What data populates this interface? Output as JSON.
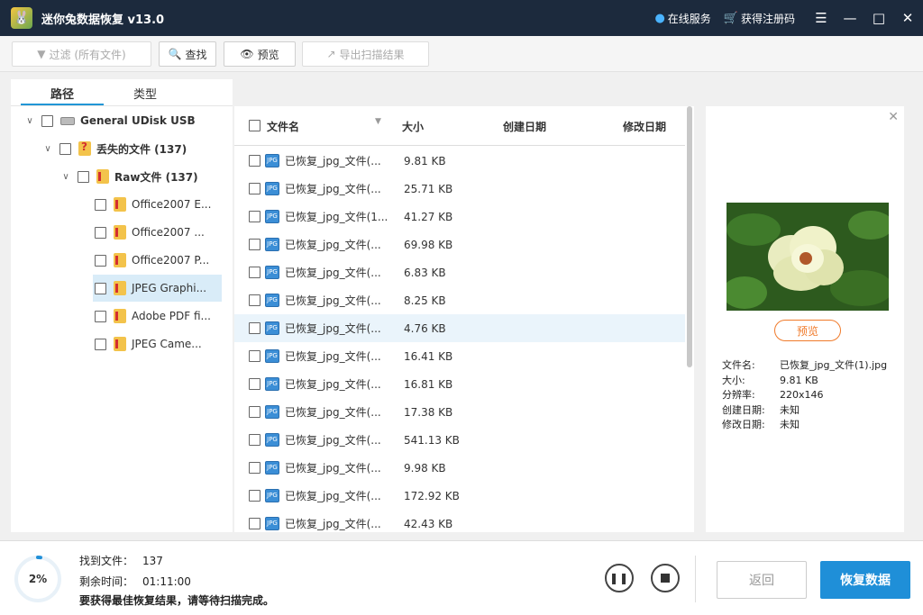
{
  "app": {
    "title": "迷你兔数据恢复 v13.0"
  },
  "titlebar": {
    "online_service": "在线服务",
    "get_code": "获得注册码"
  },
  "toolbar": {
    "filter_label": "过滤 (所有文件)",
    "search_label": "查找",
    "preview_label": "预览",
    "export_label": "导出扫描结果"
  },
  "left": {
    "tabs": [
      "路径",
      "类型"
    ],
    "tree": [
      {
        "label": "General UDisk USB",
        "bold": true
      },
      {
        "label": "丢失的文件 (137)",
        "bold": true
      },
      {
        "label": "Raw文件 (137)",
        "bold": true
      },
      {
        "label": "Office2007 E..."
      },
      {
        "label": "Office2007 ..."
      },
      {
        "label": "Office2007 P..."
      },
      {
        "label": "JPEG Graphi...",
        "selected": true
      },
      {
        "label": "Adobe PDF fi..."
      },
      {
        "label": "JPEG Came..."
      }
    ]
  },
  "list": {
    "headers": {
      "name": "文件名",
      "size": "大小",
      "created": "创建日期",
      "modified": "修改日期"
    },
    "rows": [
      {
        "name": "已恢复_jpg_文件(...",
        "size": "9.81 KB"
      },
      {
        "name": "已恢复_jpg_文件(...",
        "size": "25.71 KB"
      },
      {
        "name": "已恢复_jpg_文件(1...",
        "size": "41.27 KB"
      },
      {
        "name": "已恢复_jpg_文件(...",
        "size": "69.98 KB"
      },
      {
        "name": "已恢复_jpg_文件(...",
        "size": "6.83 KB"
      },
      {
        "name": "已恢复_jpg_文件(...",
        "size": "8.25 KB"
      },
      {
        "name": "已恢复_jpg_文件(...",
        "size": "4.76 KB",
        "selected": true
      },
      {
        "name": "已恢复_jpg_文件(...",
        "size": "16.41 KB"
      },
      {
        "name": "已恢复_jpg_文件(...",
        "size": "16.81 KB"
      },
      {
        "name": "已恢复_jpg_文件(...",
        "size": "17.38 KB"
      },
      {
        "name": "已恢复_jpg_文件(...",
        "size": "541.13 KB"
      },
      {
        "name": "已恢复_jpg_文件(...",
        "size": "9.98 KB"
      },
      {
        "name": "已恢复_jpg_文件(...",
        "size": "172.92 KB"
      },
      {
        "name": "已恢复_jpg_文件(...",
        "size": "42.43 KB"
      }
    ]
  },
  "preview": {
    "button": "预览",
    "info": [
      {
        "key": "文件名:",
        "value": "已恢复_jpg_文件(1).jpg"
      },
      {
        "key": "大小:",
        "value": "9.81 KB"
      },
      {
        "key": "分辨率:",
        "value": "220x146"
      },
      {
        "key": "创建日期:",
        "value": "未知"
      },
      {
        "key": "修改日期:",
        "value": "未知"
      }
    ]
  },
  "footer": {
    "progress_percent": 2,
    "progress_label": "2%",
    "found_label": "找到文件：",
    "found_value": "137",
    "remaining_label": "剩余时间：",
    "remaining_value": "01:11:00",
    "hint": "要获得最佳恢复结果，请等待扫描完成。",
    "back_label": "返回",
    "recover_label": "恢复数据"
  },
  "colors": {
    "accent": "#1f8fd8",
    "titlebar": "#1c2a3d",
    "preview_accent": "#f07a2a"
  }
}
